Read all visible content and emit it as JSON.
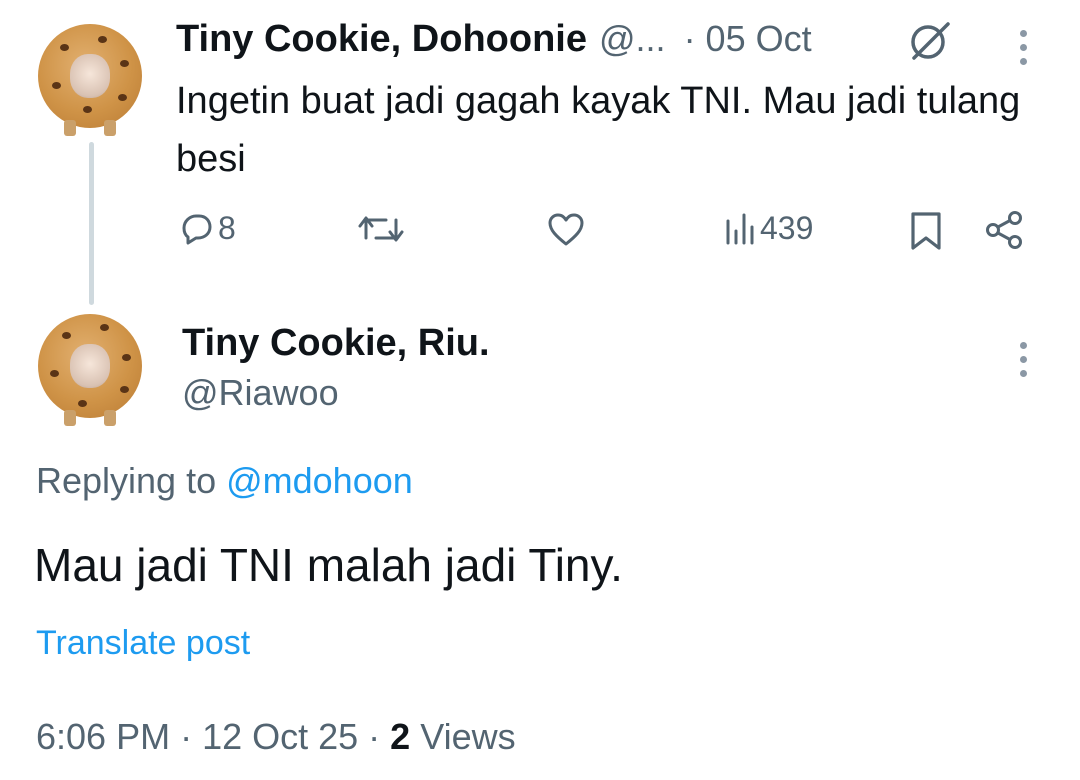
{
  "parent_post": {
    "author_name": "Tiny Cookie, Dohoonie",
    "handle_truncated": "@...",
    "date": "· 05 Oct",
    "text": "Ingetin buat jadi gagah kayak TNI. Mau jadi tulang besi",
    "replies": "8",
    "views": "439"
  },
  "reply_post": {
    "author_name": "Tiny Cookie, Riu.",
    "handle": "@Riawoo",
    "replying_label": "Replying to ",
    "replying_to": "@mdohoon",
    "text": "Mau jadi TNI malah jadi Tiny.",
    "translate": "Translate post",
    "time": "6:06 PM",
    "sep1": " · ",
    "date": "12 Oct 25",
    "sep2": " · ",
    "view_count": "2",
    "views_label": " Views"
  },
  "icons": {
    "reply": "speech-bubble-icon",
    "repost": "repost-arrows-icon",
    "like": "heart-icon",
    "views": "bar-chart-icon",
    "bookmark": "bookmark-icon",
    "share": "share-icon",
    "more": "vertical-dots-icon",
    "grok": "slashed-circle-icon"
  }
}
